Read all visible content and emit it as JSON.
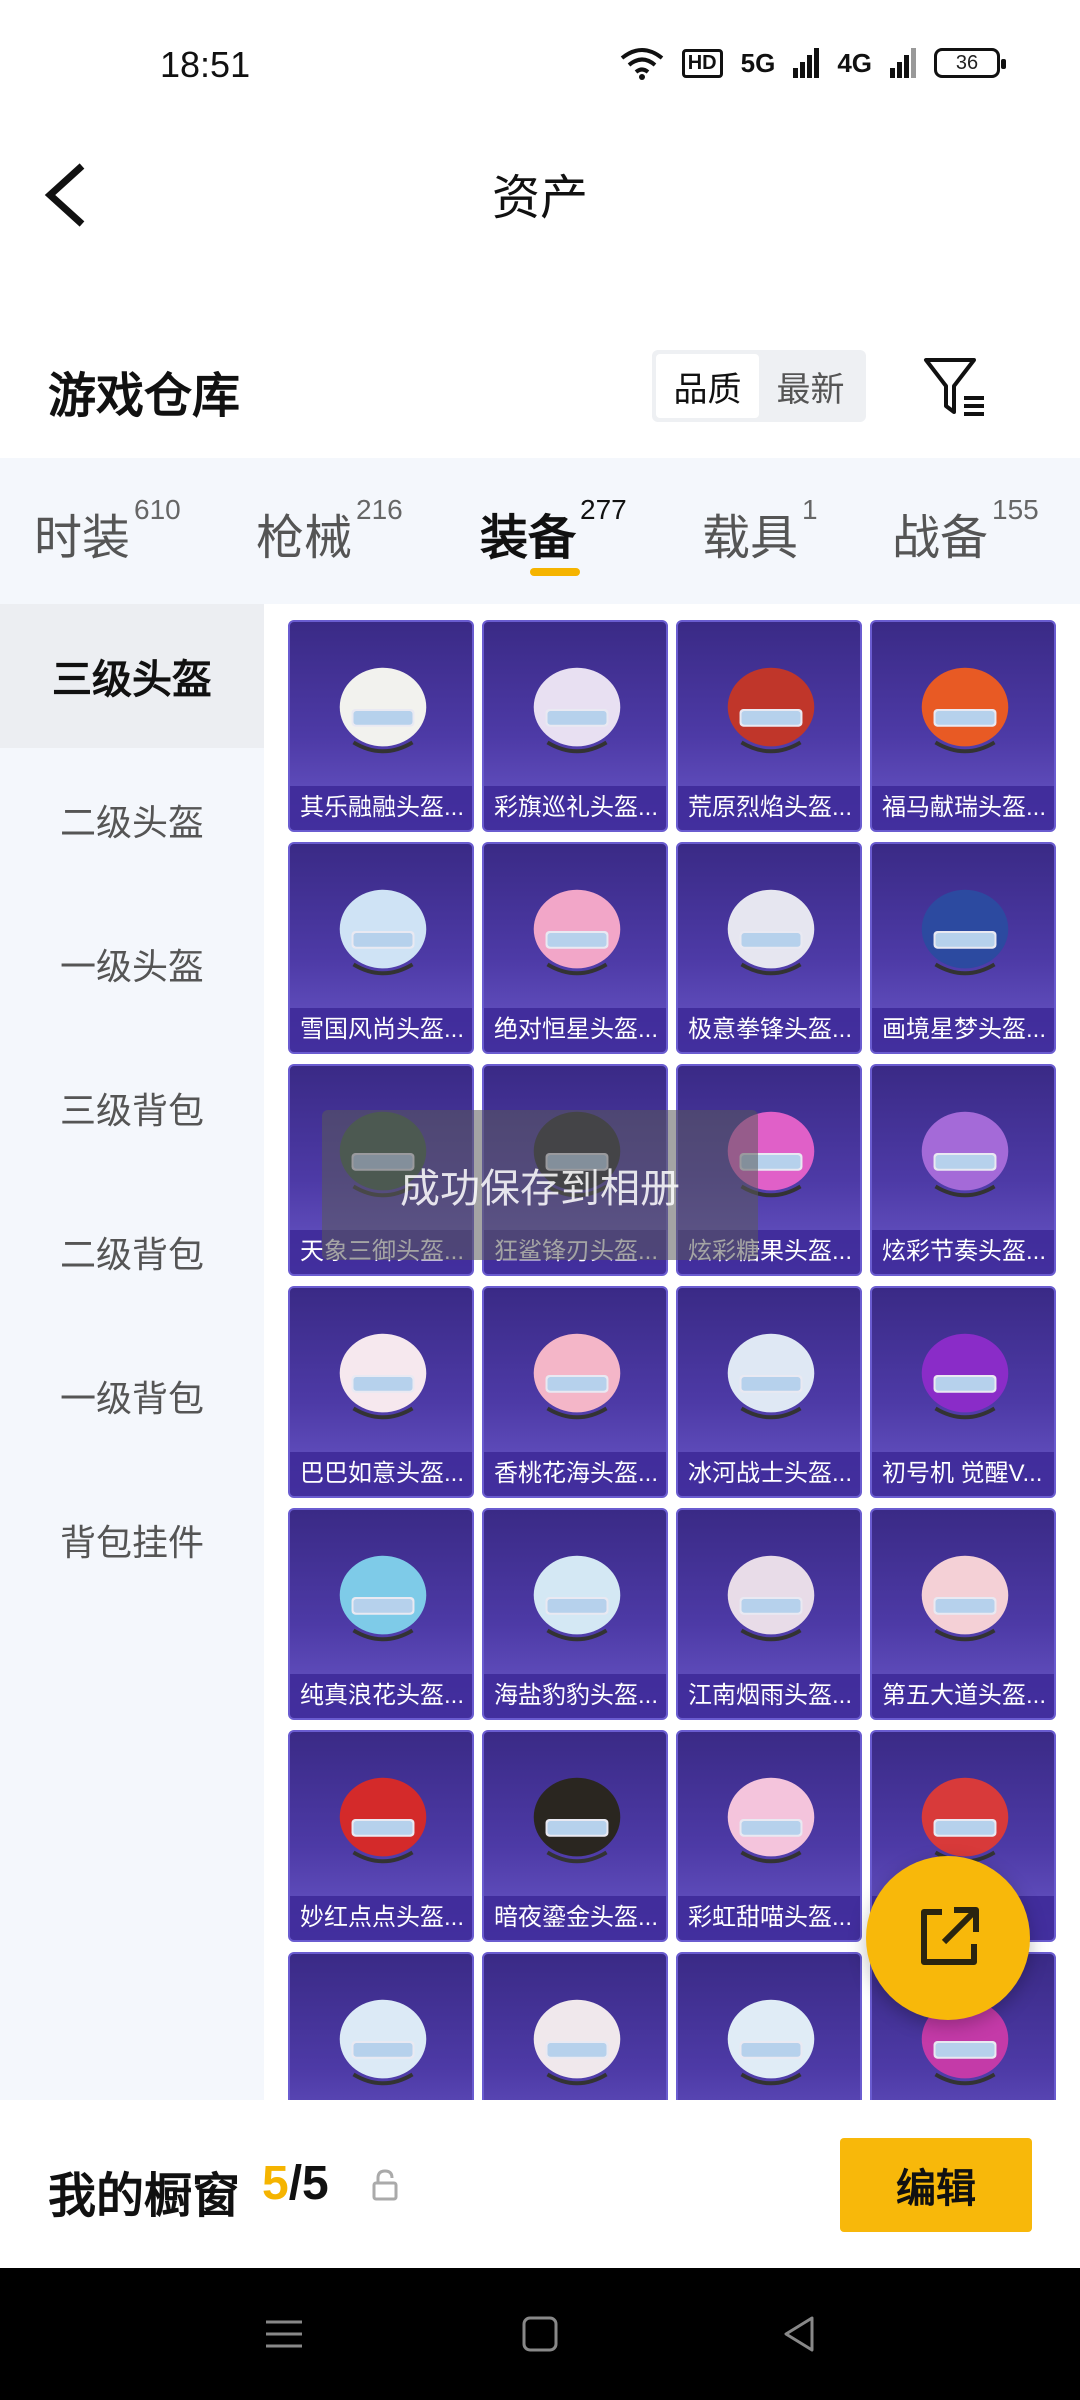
{
  "status": {
    "time": "18:51",
    "hd": "HD",
    "net1": "5G",
    "net2": "4G",
    "battery": "36"
  },
  "header": {
    "title": "资产"
  },
  "warehouse": {
    "title": "游戏仓库",
    "sort": [
      "品质",
      "最新"
    ]
  },
  "tabs": [
    {
      "label": "时装",
      "count": "610"
    },
    {
      "label": "枪械",
      "count": "216"
    },
    {
      "label": "装备",
      "count": "277"
    },
    {
      "label": "载具",
      "count": "1"
    },
    {
      "label": "战备",
      "count": "155"
    }
  ],
  "sidebar": [
    "三级头盔",
    "二级头盔",
    "一级头盔",
    "三级背包",
    "二级背包",
    "一级背包",
    "背包挂件"
  ],
  "items": [
    {
      "name": "其乐融融头盔...",
      "color": "#f2f2ee"
    },
    {
      "name": "彩旗巡礼头盔...",
      "color": "#e8e0f2"
    },
    {
      "name": "荒原烈焰头盔...",
      "color": "#c0362a"
    },
    {
      "name": "福马献瑞头盔...",
      "color": "#e85a24"
    },
    {
      "name": "雪国风尚头盔...",
      "color": "#cfe3f5"
    },
    {
      "name": "绝对恒星头盔...",
      "color": "#f2a6c8"
    },
    {
      "name": "极意拳锋头盔...",
      "color": "#e6e6f0"
    },
    {
      "name": "画境星梦头盔...",
      "color": "#2c4aa0"
    },
    {
      "name": "天象三御头盔...",
      "color": "#3c5a48"
    },
    {
      "name": "狂鲨锋刃头盔...",
      "color": "#2a2a32"
    },
    {
      "name": "炫彩糖果头盔...",
      "color": "#e060c8"
    },
    {
      "name": "炫彩节奏头盔...",
      "color": "#a46ad8"
    },
    {
      "name": "巴巴如意头盔...",
      "color": "#f6e8ee"
    },
    {
      "name": "香桃花海头盔...",
      "color": "#f4b6c8"
    },
    {
      "name": "冰河战士头盔...",
      "color": "#dfe8f4"
    },
    {
      "name": "初号机 觉醒V...",
      "color": "#8a2cc8"
    },
    {
      "name": "纯真浪花头盔...",
      "color": "#7ecbe8"
    },
    {
      "name": "海盐豹豹头盔...",
      "color": "#d4e8f4"
    },
    {
      "name": "江南烟雨头盔...",
      "color": "#e8dce8"
    },
    {
      "name": "第五大道头盔...",
      "color": "#f4d0d6"
    },
    {
      "name": "妙红点点头盔...",
      "color": "#d42a2a"
    },
    {
      "name": "暗夜鎏金头盔...",
      "color": "#2a2620"
    },
    {
      "name": "彩虹甜喵头盔...",
      "color": "#f4c4dc"
    },
    {
      "name": "",
      "color": "#d83a3a"
    },
    {
      "name": "",
      "color": "#dceaf6"
    },
    {
      "name": "",
      "color": "#f0e8ec"
    },
    {
      "name": "",
      "color": "#e0ecf6"
    },
    {
      "name": "",
      "color": "#c43aa8"
    }
  ],
  "toast": "成功保存到相册",
  "showcase": {
    "title": "我的橱窗",
    "current": "5",
    "sep": "/",
    "total": "5",
    "edit": "编辑"
  }
}
